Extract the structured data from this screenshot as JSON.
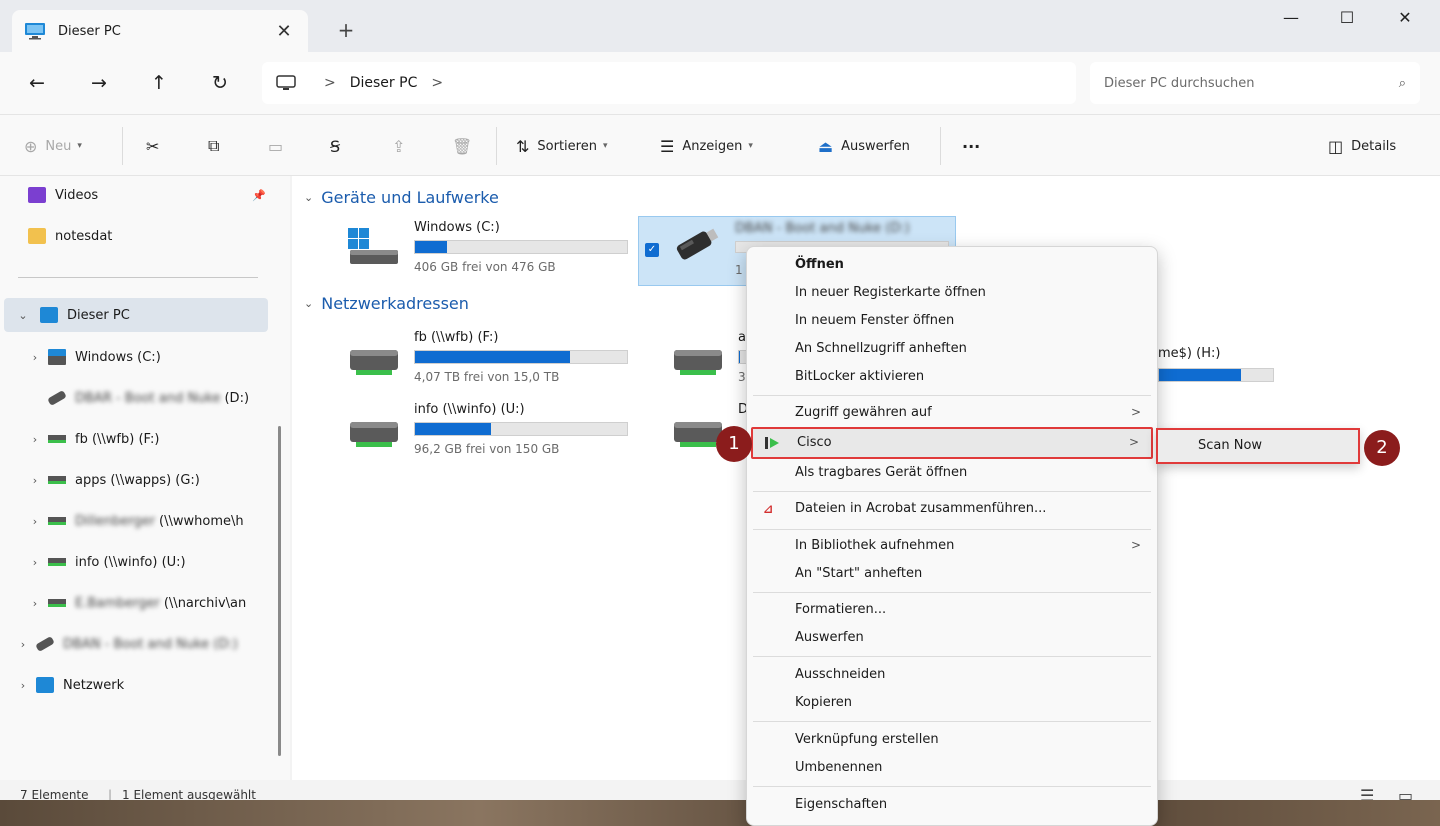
{
  "window": {
    "tab_title": "Dieser PC",
    "tab_close": "✕",
    "new_tab": "+",
    "minimize": "—",
    "maximize": "☐",
    "close": "✕"
  },
  "nav": {
    "back": "←",
    "forward": "→",
    "up": "↑",
    "refresh": "↻"
  },
  "address": {
    "separator1": ">",
    "crumb": "Dieser PC",
    "separator2": ">"
  },
  "search": {
    "placeholder": "Dieser PC durchsuchen",
    "icon": "⌕"
  },
  "toolbar": {
    "new_label": "Neu",
    "sort_label": "Sortieren",
    "view_label": "Anzeigen",
    "eject_label": "Auswerfen",
    "more_label": "···",
    "details_label": "Details"
  },
  "sidebar": {
    "items": [
      {
        "label": "Videos"
      },
      {
        "label": "notesdat"
      },
      {
        "label": "Dieser PC"
      },
      {
        "label": "Windows (C:)"
      },
      {
        "label": "DBAR - Boot and Nuke",
        "suffix": "(D:)"
      },
      {
        "label": "fb (\\\\wfb) (F:)"
      },
      {
        "label": "apps (\\\\wapps) (G:)"
      },
      {
        "label": "Dillenberger",
        "suffix": "(\\\\wwhome\\h"
      },
      {
        "label": "info (\\\\winfo) (U:)"
      },
      {
        "label": "E.Bamberger",
        "suffix": "(\\\\narchiv\\an"
      },
      {
        "label": "DBAN - Boot and Nuke (D:)"
      },
      {
        "label": "Netzwerk"
      }
    ]
  },
  "main": {
    "group_devices": "Geräte und Laufwerke",
    "group_network": "Netzwerkadressen",
    "drives": [
      {
        "name": "Windows (C:)",
        "free": "406 GB frei von 476 GB",
        "usage": 0.15
      },
      {
        "name": "DBAN - Boot and Nuke (D:)",
        "free": "1",
        "usage": 0.0
      },
      {
        "name": "fb (\\\\wfb) (F:)",
        "free": "4,07 TB frei von 15,0 TB",
        "usage": 0.73
      },
      {
        "name": "a",
        "free": "3",
        "usage": 0.05
      },
      {
        "name": "me$) (H:)",
        "free": "",
        "usage": 0.72
      },
      {
        "name": "info (\\\\winfo) (U:)",
        "free": "96,2 GB frei von 150 GB",
        "usage": 0.36
      },
      {
        "name": "D",
        "free": "",
        "usage": 0.0
      }
    ]
  },
  "status": {
    "count": "7 Elemente",
    "selected": "1 Element ausgewählt"
  },
  "context_menu": {
    "items": [
      {
        "label": "Öffnen"
      },
      {
        "label": "In neuer Registerkarte öffnen"
      },
      {
        "label": "In neuem Fenster öffnen"
      },
      {
        "label": "An Schnellzugriff anheften"
      },
      {
        "label": "BitLocker aktivieren"
      },
      {
        "label": "Zugriff gewähren auf"
      },
      {
        "label": "Cisco"
      },
      {
        "label": "Als tragbares Gerät öffnen"
      },
      {
        "label": "Dateien in Acrobat zusammenführen..."
      },
      {
        "label": "In Bibliothek aufnehmen"
      },
      {
        "label": "An \"Start\" anheften"
      },
      {
        "label": "Formatieren..."
      },
      {
        "label": "Auswerfen"
      },
      {
        "label": "Ausschneiden"
      },
      {
        "label": "Kopieren"
      },
      {
        "label": "Verknüpfung erstellen"
      },
      {
        "label": "Umbenennen"
      },
      {
        "label": "Eigenschaften"
      }
    ],
    "arrow": ">"
  },
  "submenu": {
    "scan_now": "Scan Now"
  },
  "annotations": {
    "badge1": "1",
    "badge2": "2"
  },
  "colors": {
    "accent": "#0f6cd1",
    "highlight_border": "#e03a3a",
    "badge": "#8b1c1c"
  }
}
